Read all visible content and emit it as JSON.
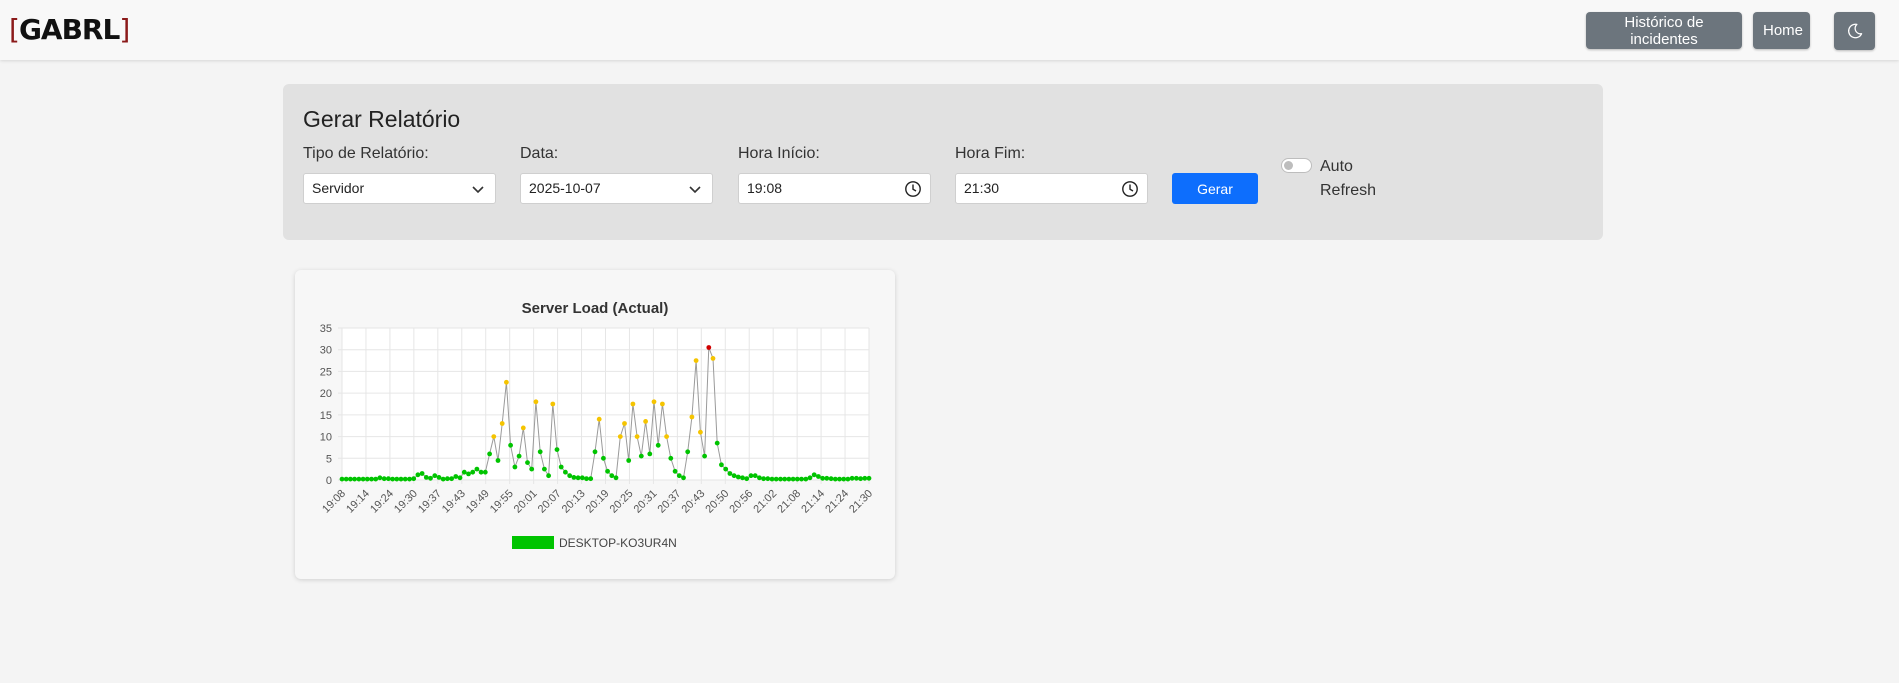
{
  "logo": {
    "text": "GABRL",
    "bracket_left": "[",
    "bracket_right": "]"
  },
  "nav": {
    "history_label": "Histórico de incidentes",
    "home_label": "Home",
    "theme_icon": "moon-icon"
  },
  "report": {
    "title": "Gerar Relatório",
    "type_label": "Tipo de Relatório:",
    "type_value": "Servidor",
    "date_label": "Data:",
    "date_value": "2025-10-07",
    "start_label": "Hora Início:",
    "start_value": "19:08",
    "end_label": "Hora Fim:",
    "end_value": "21:30",
    "submit_label": "Gerar",
    "auto_refresh_label": "Auto Refresh",
    "auto_refresh_on": false
  },
  "colors": {
    "primary": "#0d6efd",
    "secondary": "#6c757d",
    "ok": "#00c400",
    "warn": "#f5c400",
    "critical": "#d00000"
  },
  "chart_data": {
    "type": "line",
    "title": "Server Load (Actual)",
    "ylim": [
      0,
      35
    ],
    "yticks": [
      "0",
      "5",
      "10",
      "15",
      "20",
      "25",
      "30",
      "35"
    ],
    "xtick_labels": [
      "19:08",
      "19:14",
      "19:24",
      "19:30",
      "19:37",
      "19:43",
      "19:49",
      "19:55",
      "20:01",
      "20:07",
      "20:13",
      "20:19",
      "20:25",
      "20:31",
      "20:37",
      "20:43",
      "20:50",
      "20:56",
      "21:02",
      "21:08",
      "21:14",
      "21:24",
      "21:30"
    ],
    "grid": true,
    "legend": "bottom",
    "series": [
      {
        "name": "DESKTOP-KO3UR4N",
        "values": [
          0.2,
          0.2,
          0.2,
          0.2,
          0.2,
          0.2,
          0.2,
          0.2,
          0.2,
          0.5,
          0.3,
          0.3,
          0.2,
          0.2,
          0.2,
          0.2,
          0.2,
          0.3,
          1.2,
          1.5,
          0.6,
          0.4,
          1.0,
          0.6,
          0.2,
          0.3,
          0.3,
          0.8,
          0.5,
          1.8,
          1.4,
          1.8,
          2.5,
          1.8,
          1.8,
          6.0,
          10,
          4.5,
          13,
          22.5,
          8,
          3,
          5.5,
          12,
          4,
          2.5,
          18,
          6.5,
          2.5,
          1,
          17.5,
          7,
          3,
          1.8,
          1,
          0.6,
          0.5,
          0.5,
          0.3,
          0.3,
          6.5,
          14,
          5,
          2,
          1,
          0.5,
          10,
          13,
          4.5,
          17.5,
          10,
          5.5,
          13.5,
          6,
          18,
          8,
          17.5,
          10,
          5,
          2,
          1,
          0.5,
          6.5,
          14.5,
          27.5,
          11,
          5.5,
          30.5,
          28,
          8.5,
          3.5,
          2.5,
          1.5,
          1,
          0.7,
          0.5,
          0.3,
          1,
          1,
          0.5,
          0.3,
          0.3,
          0.2,
          0.2,
          0.2,
          0.2,
          0.2,
          0.2,
          0.2,
          0.2,
          0.2,
          0.5,
          1.2,
          0.8,
          0.4,
          0.4,
          0.3,
          0.2,
          0.2,
          0.2,
          0.2,
          0.4,
          0.4,
          0.3,
          0.4,
          0.4
        ]
      }
    ],
    "thresholds": {
      "warning": 10,
      "critical": 30
    }
  }
}
